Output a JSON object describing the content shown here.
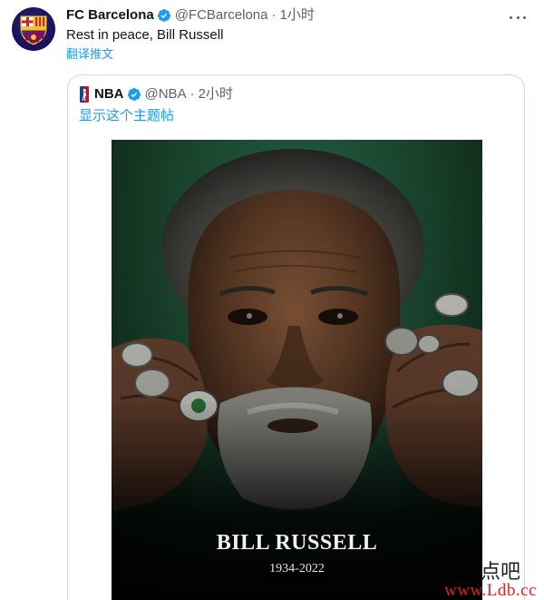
{
  "tweet": {
    "display_name": "FC Barcelona",
    "handle": "@FCBarcelona",
    "separator": "·",
    "time": "1小时",
    "text": "Rest in peace, Bill Russell",
    "translate_label": "翻译推文"
  },
  "quoted_tweet": {
    "display_name": "NBA",
    "handle": "@NBA",
    "separator": "·",
    "time": "2小时",
    "show_thread_label": "显示这个主题帖",
    "poster": {
      "name": "BILL RUSSELL",
      "years": "1934-2022"
    }
  },
  "watermark": {
    "text_cn": "点吧",
    "url": "www.Ldb.cc"
  },
  "colors": {
    "link": "#1d9bf0",
    "verified": "#1d9bf0",
    "secondary_text": "#536471",
    "border": "#cfd9de"
  },
  "icons": [
    "barcelona-crest-icon",
    "verified-badge-icon",
    "more-options-icon",
    "nba-logo-icon"
  ]
}
